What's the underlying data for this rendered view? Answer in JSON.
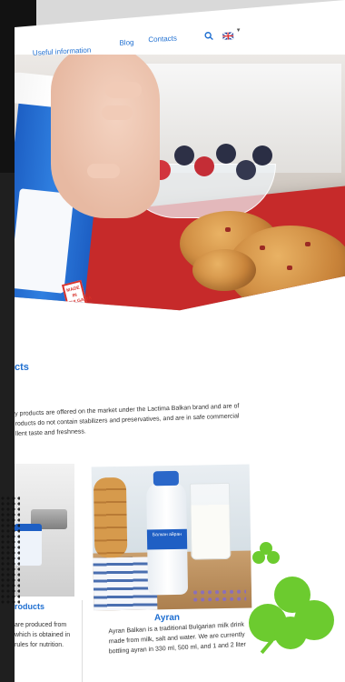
{
  "nav": {
    "useful_information": "Useful information",
    "blog": "Blog",
    "contacts": "Contacts",
    "search_icon": "search-icon",
    "language_flag": "uk-flag-icon"
  },
  "hero": {
    "cup_stamp": "MADE IN BULGARIA"
  },
  "products": {
    "title": "cts",
    "intro_line1": "y products are offered on the market under the Lactima Balkan brand and are of",
    "intro_line2": "roducts do not contain stabilizers and preservatives, and are in safe commercial",
    "intro_line3": "llent taste and freshness."
  },
  "cards": {
    "left": {
      "title": "roducts",
      "text_line1": "are produced from",
      "text_line2": "which is obtained in",
      "text_line3": "rules for nutrition."
    },
    "right": {
      "bottle_label": "Балкан айран",
      "title": "Ayran",
      "text_line1": "Ayran Balkan is a traditional Bulgarian milk drink",
      "text_line2": "made from milk, salt and water. We are currently",
      "text_line3": "bottling ayran in 330 ml, 500 ml, and 1 and 2 liter"
    }
  },
  "colors": {
    "brand_blue": "#1f6fd1",
    "clover_green": "#6ccb2f",
    "tray_red": "#c62a2a"
  }
}
